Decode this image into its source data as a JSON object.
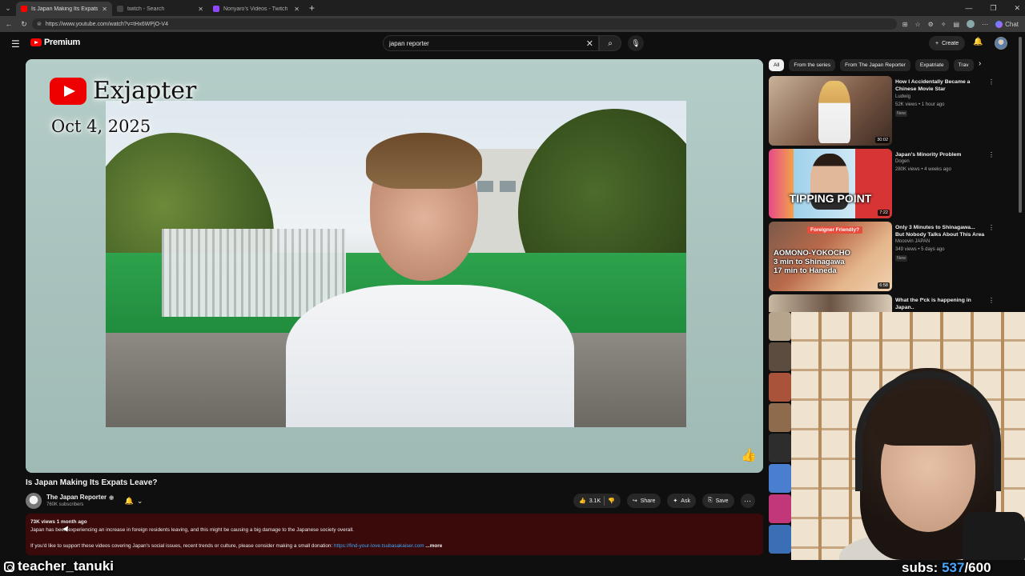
{
  "browser": {
    "tabs": [
      {
        "title": "Is Japan Making Its Expats Lea",
        "active": true,
        "color": "#ff0000"
      },
      {
        "title": "twitch - Search",
        "active": false,
        "color": "#444444"
      },
      {
        "title": "Noriyaro's Videos - Twitch",
        "active": false,
        "color": "#9146ff"
      }
    ],
    "url": "https://www.youtube.com/watch?v=tHx6WPjO-V4",
    "chat_label": "Chat"
  },
  "youtube": {
    "logo_text": "Premium",
    "search_value": "japan reporter",
    "create_label": "Create"
  },
  "player": {
    "brand_name": "Exjapter",
    "date": "Oct 4, 2025"
  },
  "video": {
    "title": "Is Japan Making Its Expats Leave?",
    "channel": "The Japan Reporter",
    "subscribers": "760K subscribers",
    "likes": "3.1K",
    "share_label": "Share",
    "ask_label": "Ask",
    "save_label": "Save",
    "views": "73K views",
    "age": "1 month ago",
    "description_line1": "Japan has been experiencing an increase in foreign residents leaving, and this might be causing a big damage to the Japanese society overall.",
    "description_line2": "If you'd like to support these videos covering Japan's social issues, recent trends or culture, please consider making a small donation: ",
    "donation_link": "https://find-your-love.tsubasakaiser.com",
    "more_label": "...more"
  },
  "chips": [
    "All",
    "From the series",
    "From The Japan Reporter",
    "Expatriate",
    "Trav"
  ],
  "recommendations": [
    {
      "title": "How I Accidentally Became a Chinese Movie Star",
      "channel": "Ludwig",
      "meta": "52K views • 1 hour ago",
      "badge": "New",
      "duration": "30:02"
    },
    {
      "title": "Japan's Minority Problem",
      "channel": "Dogen",
      "meta": "280K views • 4 weeks ago",
      "badge": "",
      "duration": "7:22",
      "thumb_text": "TIPPING POINT"
    },
    {
      "title": "Only 3 Minutes to Shinagawa... But Nobody Talks About This Area",
      "channel": "Mooovin JAPAN",
      "meta": "349 views • 5 days ago",
      "badge": "New",
      "duration": "6:58",
      "thumb_badge": "Foreigner Friendly?",
      "thumb_lines": [
        "AOMONO-YOKOCHO",
        "3 min to Shinagawa",
        "17 min to Haneda"
      ]
    },
    {
      "title": "What the f*ck is happening in Japan..",
      "channel": "",
      "meta": "",
      "badge": "",
      "duration": ""
    }
  ],
  "overlay": {
    "handle": "teacher_tanuki",
    "subs_label": "subs:",
    "subs_current": "537",
    "subs_goal": "/600"
  },
  "colors": {
    "youtube_red": "#ff0000",
    "link_blue": "#3ea6ff",
    "description_bg": "#3a0a0a"
  }
}
